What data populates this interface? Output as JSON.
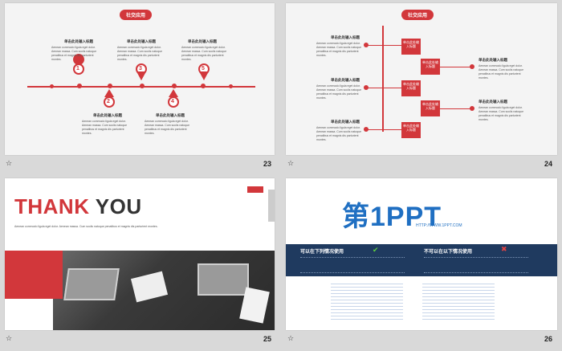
{
  "slides": [
    {
      "number": "23",
      "title_pill": "社交应用"
    },
    {
      "number": "24",
      "title_pill": "社交应用"
    },
    {
      "number": "25",
      "thank_red": "THANK",
      "thank_dark": "YOU"
    },
    {
      "number": "26",
      "logo_main": "第1PPT",
      "logo_url": "HTTP://WWW.1PPT.COM",
      "can_use_title": "可以在下列情况使用",
      "cannot_use_title": "不可以在以下情况使用"
    }
  ],
  "timeline": {
    "heading": "单击此处输入标题",
    "markers": [
      "1",
      "2",
      "3",
      "4",
      "5"
    ],
    "body": "Aenean commodo ligula eget dolor. Aenean massa. Cum sociis natoque penatibus et magnis dis parturient montes."
  },
  "tree": {
    "heading": "单击此处输入标题",
    "box_label": "单击此处输入标题"
  },
  "footer_icon": "star-icon",
  "colors": {
    "accent": "#d2373b",
    "navy": "#1f3a5f"
  }
}
